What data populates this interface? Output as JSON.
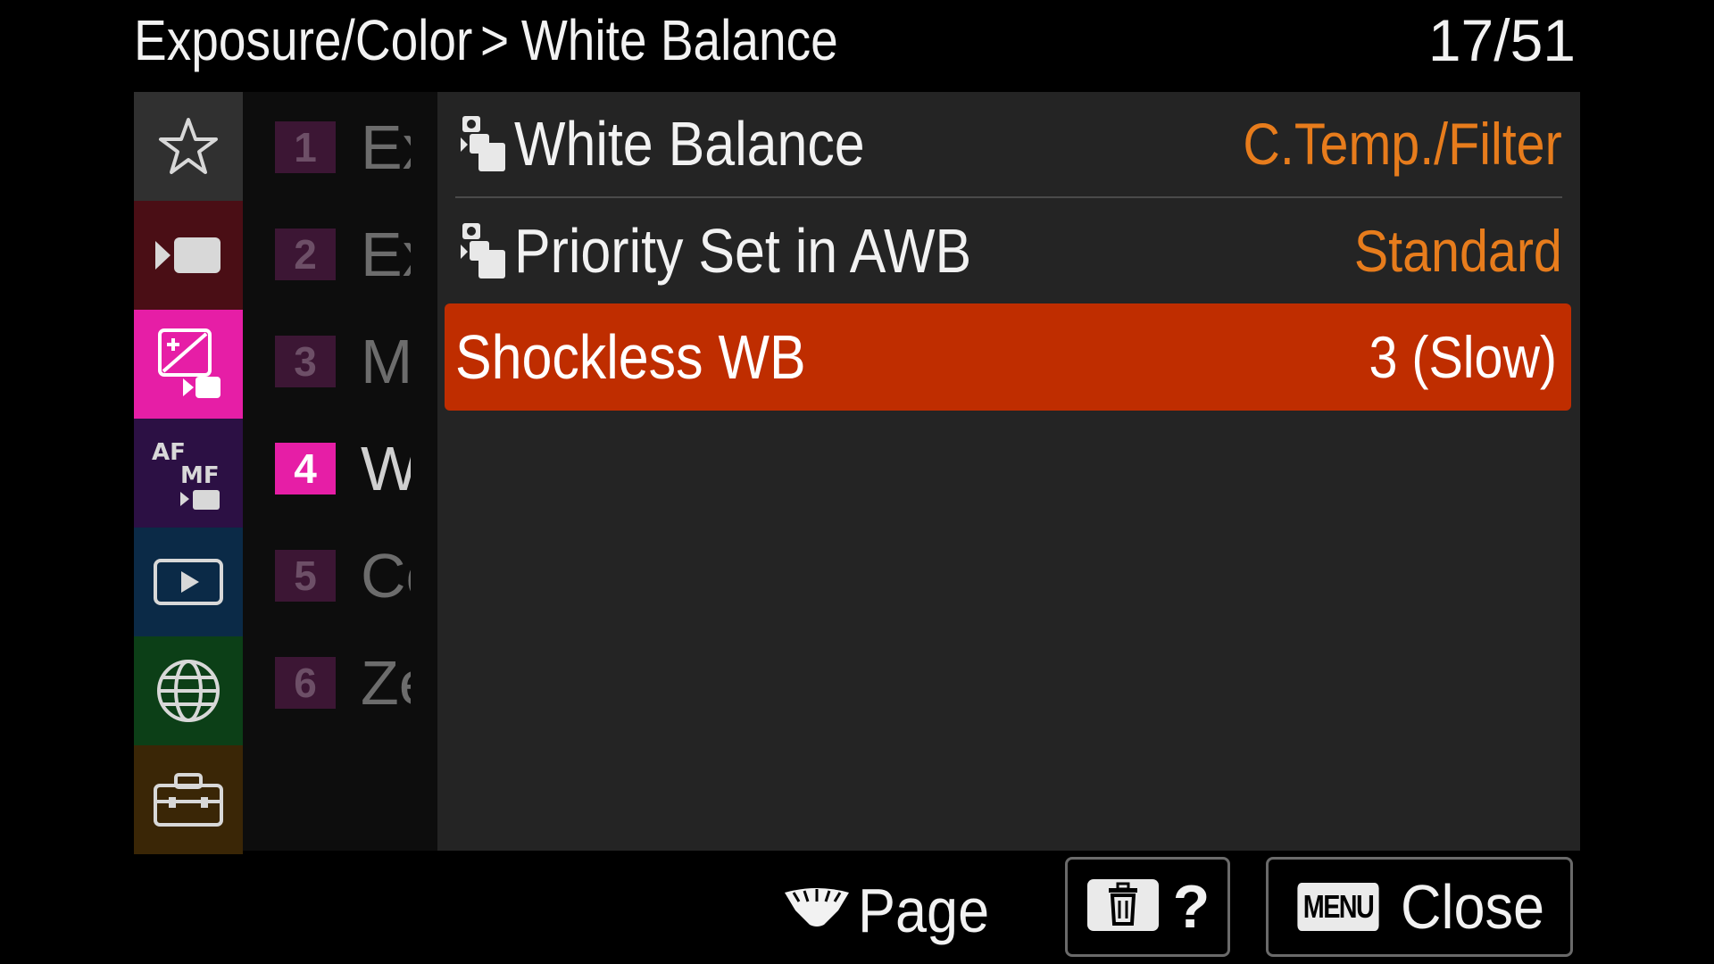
{
  "header": {
    "section": "Exposure/Color",
    "separator": ">",
    "title": "White Balance",
    "page_counter": "17/51"
  },
  "categories": [
    {
      "icon": "star-icon",
      "color": "#303030",
      "active": false
    },
    {
      "icon": "movie-icon",
      "color": "#4a0e15",
      "active": false
    },
    {
      "icon": "exposure-color-icon",
      "color": "#e61ea6",
      "active": true
    },
    {
      "icon": "af-mf-icon",
      "color": "#2c1044",
      "active": false
    },
    {
      "icon": "playback-icon",
      "color": "#0b2a47",
      "active": false
    },
    {
      "icon": "network-icon",
      "color": "#0c3f17",
      "active": false
    },
    {
      "icon": "setup-toolbox-icon",
      "color": "#3a2606",
      "active": false
    }
  ],
  "af_icon_text": {
    "af": "AF",
    "mf": "MF"
  },
  "pages": [
    {
      "num": "1",
      "name": "Ex",
      "active": false
    },
    {
      "num": "2",
      "name": "Ex",
      "active": false
    },
    {
      "num": "3",
      "name": "M",
      "active": false
    },
    {
      "num": "4",
      "name": "W",
      "active": true
    },
    {
      "num": "5",
      "name": "Co",
      "active": false
    },
    {
      "num": "6",
      "name": "Ze",
      "active": false
    }
  ],
  "menu_items": [
    {
      "label": "White Balance",
      "value": "C.Temp./Filter",
      "icon": "still-movie-icon",
      "selected": false
    },
    {
      "label": "Priority Set in AWB",
      "value": "Standard",
      "icon": "still-movie-icon",
      "selected": false
    },
    {
      "label": "Shockless WB",
      "value": "3 (Slow)",
      "icon": "",
      "selected": true
    }
  ],
  "footer": {
    "page_label": "Page",
    "help_label": "?",
    "menu_tag": "MENU",
    "close_label": "Close"
  },
  "colors": {
    "value_orange": "#e77c1c",
    "selection_red": "#bf2d00",
    "active_pink": "#e61ea6"
  }
}
